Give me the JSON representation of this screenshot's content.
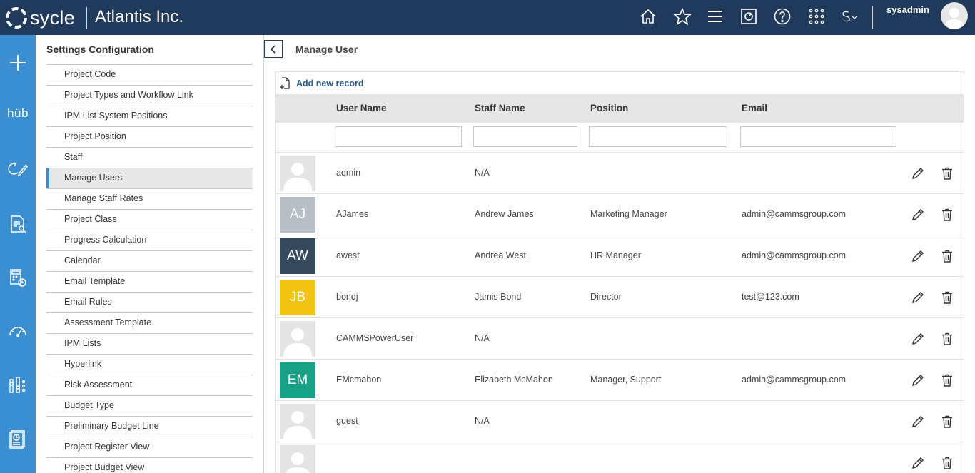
{
  "header": {
    "logo_text": "sycle",
    "company": "Atlantis Inc.",
    "username": "sysadmin",
    "icons": [
      "home-icon",
      "star-icon",
      "menu-icon",
      "vault-icon",
      "help-icon",
      "apps-grid-icon",
      "sycle-dropdown-icon"
    ]
  },
  "rail": {
    "hub_label": "hüb",
    "items": [
      "add-icon",
      "hub-logo",
      "edit-cycle-icon",
      "report-search-icon",
      "calculator-clock-icon",
      "gauge-icon",
      "analytics-icon",
      "dashboard-report-icon"
    ]
  },
  "settings": {
    "title": "Settings Configuration",
    "items": [
      "Project Code",
      "Project Types and Workflow Link",
      "IPM List System Positions",
      "Project Position",
      "Staff",
      "Manage Users",
      "Manage Staff Rates",
      "Project Class",
      "Progress Calculation",
      "Calendar",
      "Email Template",
      "Email Rules",
      "Assessment Template",
      "IPM Lists",
      "Hyperlink",
      "Risk Assessment",
      "Budget Type",
      "Preliminary Budget Line",
      "Project Register View",
      "Project Budget View"
    ],
    "active": "Manage Users"
  },
  "main": {
    "title": "Manage User",
    "add_record": "Add new record",
    "columns": {
      "user_name": "User Name",
      "staff_name": "Staff Name",
      "position": "Position",
      "email": "Email"
    },
    "filters": {
      "user_name": "",
      "staff_name": "",
      "position": "",
      "email": ""
    },
    "rows": [
      {
        "initials": "",
        "color": "",
        "user_name": "admin",
        "staff_name": "N/A",
        "position": "",
        "email": ""
      },
      {
        "initials": "AJ",
        "color": "#b9bfc6",
        "user_name": "AJames",
        "staff_name": "Andrew James",
        "position": "Marketing Manager",
        "email": "admin@cammsgroup.com"
      },
      {
        "initials": "AW",
        "color": "#34495e",
        "user_name": "awest",
        "staff_name": "Andrea West",
        "position": "HR Manager",
        "email": "admin@cammsgroup.com"
      },
      {
        "initials": "JB",
        "color": "#f1c40f",
        "user_name": "bondj",
        "staff_name": "Jamis Bond",
        "position": "Director",
        "email": "test@123.com"
      },
      {
        "initials": "",
        "color": "",
        "user_name": "CAMMSPowerUser",
        "staff_name": "N/A",
        "position": "",
        "email": ""
      },
      {
        "initials": "EM",
        "color": "#16a085",
        "user_name": "EMcmahon",
        "staff_name": "Elizabeth McMahon",
        "position": "Manager, Support",
        "email": "admin@cammsgroup.com"
      },
      {
        "initials": "",
        "color": "",
        "user_name": "guest",
        "staff_name": "N/A",
        "position": "",
        "email": ""
      },
      {
        "initials": "",
        "color": "",
        "user_name": "",
        "staff_name": "",
        "position": "",
        "email": ""
      }
    ]
  }
}
